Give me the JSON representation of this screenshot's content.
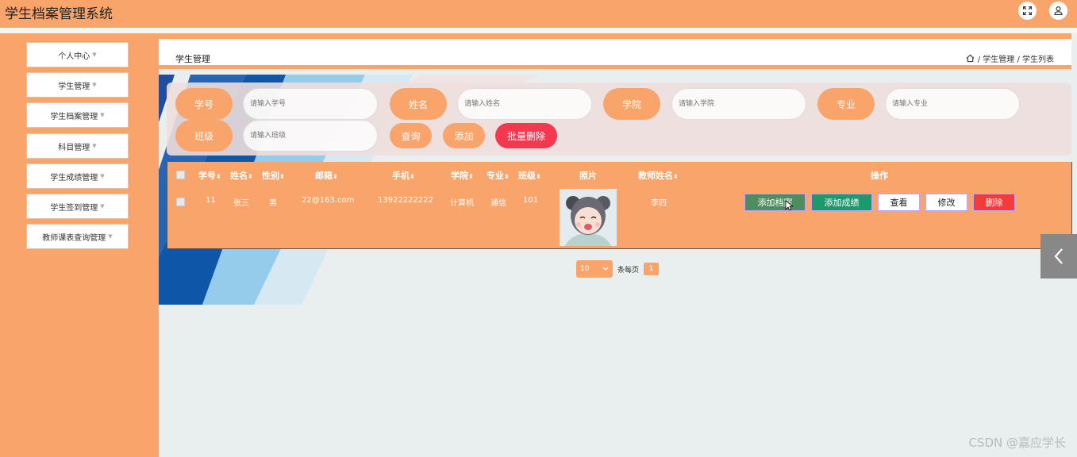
{
  "app": {
    "title": "学生档案管理系统"
  },
  "header_icons": [
    "fullscreen-icon",
    "user-icon"
  ],
  "sidebar": {
    "items": [
      {
        "label": "个人中心"
      },
      {
        "label": "学生管理"
      },
      {
        "label": "学生档案管理"
      },
      {
        "label": "科目管理"
      },
      {
        "label": "学生成绩管理"
      },
      {
        "label": "学生签到管理"
      },
      {
        "label": "教师课表查询管理"
      }
    ],
    "caret": "▼"
  },
  "breadcrumb": {
    "title": "学生管理",
    "path": "/ 学生管理 / 学生列表"
  },
  "search": {
    "fields": [
      {
        "label": "学号",
        "placeholder": "请输入学号"
      },
      {
        "label": "姓名",
        "placeholder": "请输入姓名"
      },
      {
        "label": "学院",
        "placeholder": "请输入学院"
      },
      {
        "label": "专业",
        "placeholder": "请输入专业"
      },
      {
        "label": "班级",
        "placeholder": "请输入班级"
      }
    ],
    "query_label": "查询",
    "add_label": "添加",
    "batch_delete_label": "批量删除"
  },
  "table": {
    "columns": [
      "学号",
      "姓名",
      "性别",
      "邮箱",
      "手机",
      "学院",
      "专业",
      "班级",
      "照片",
      "教师姓名",
      "操作"
    ],
    "sort_icon": "⬍",
    "rows": [
      {
        "student_id": "11",
        "name": "张三",
        "gender": "男",
        "email": "22@163.com",
        "phone": "13922222222",
        "college": "计算机",
        "major": "通信",
        "class": "101",
        "teacher": "李四"
      }
    ],
    "actions": {
      "add_archive": "添加档案",
      "add_score": "添加成绩",
      "view": "查看",
      "edit": "修改",
      "delete": "删除"
    }
  },
  "pagination": {
    "page_size": "10",
    "per_page_label": "条每页",
    "current_page": "1"
  },
  "watermark": "CSDN @嘉应学长",
  "colors": {
    "accent": "#f9a46a",
    "danger": "#f5374f",
    "green_dark": "#4e8e5e",
    "green": "#1d9a6c",
    "delete_red": "#f53a3a"
  }
}
